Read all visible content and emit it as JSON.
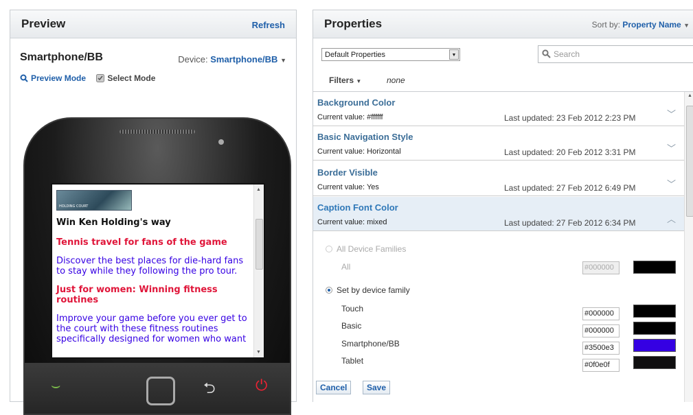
{
  "preview": {
    "title": "Preview",
    "refresh_label": "Refresh",
    "device_title": "Smartphone/BB",
    "device_label": "Device:",
    "device_value": "Smartphone/BB",
    "modes": {
      "preview_label": "Preview Mode",
      "select_label": "Select Mode"
    },
    "screen": {
      "thumb_caption": "HOLDING COURT",
      "title": "Win Ken Holding's way",
      "heading_1": "Tennis travel for fans of the game",
      "text_1": "Discover the best places for die-hard fans to stay while they following the pro tour.",
      "heading_2": "Just for women: Winning fitness routines",
      "text_2": "Improve your game before you ever get to the court with these fitness routines specifically designed for women who want"
    }
  },
  "properties": {
    "title": "Properties",
    "sort_label": "Sort by:",
    "sort_value": "Property Name",
    "select_value": "Default Properties",
    "search_placeholder": "Search",
    "filters_label": "Filters",
    "filters_value": "none",
    "items": [
      {
        "name": "Background Color",
        "current": "Current value: #ffffff",
        "updated": "Last updated: 23 Feb 2012 2:23 PM"
      },
      {
        "name": "Basic Navigation Style",
        "current": "Current value: Horizontal",
        "updated": "Last updated: 20 Feb 2012 3:31 PM"
      },
      {
        "name": "Border Visible",
        "current": "Current value: Yes",
        "updated": "Last updated: 27 Feb 2012 6:49 PM"
      },
      {
        "name": "Caption Font Color",
        "current": "Current value: mixed",
        "updated": "Last updated: 27 Feb 2012 6:34 PM"
      }
    ],
    "expanded": {
      "all_families_label": "All Device Families",
      "all_label": "All",
      "all_hex": "#000000",
      "by_family_label": "Set by device family",
      "families": [
        {
          "label": "Touch",
          "hex": "#000000",
          "color": "#000000"
        },
        {
          "label": "Basic",
          "hex": "#000000",
          "color": "#000000"
        },
        {
          "label": "Smartphone/BB",
          "hex": "#3500e3",
          "color": "#3500e3"
        },
        {
          "label": "Tablet",
          "hex": "#0f0e0f",
          "color": "#0f0e0f"
        }
      ],
      "cancel_label": "Cancel",
      "save_label": "Save"
    }
  }
}
